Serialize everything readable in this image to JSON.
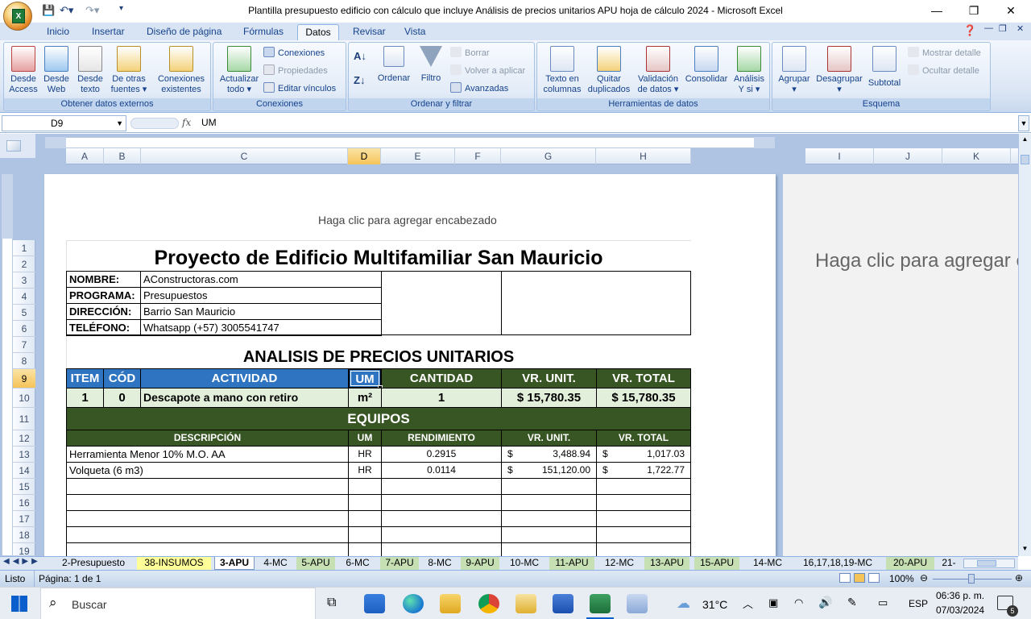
{
  "window": {
    "title": "Plantilla presupuesto edificio con cálculo que incluye Análisis de precios unitarios APU  hoja de cálculo 2024 - Microsoft Excel",
    "office_logo": "X"
  },
  "ribbon_tabs": [
    "Inicio",
    "Insertar",
    "Diseño de página",
    "Fórmulas",
    "Datos",
    "Revisar",
    "Vista"
  ],
  "active_tab": "Datos",
  "ribbon": {
    "g1": {
      "label": "Obtener datos externos",
      "btn1": "Desde\nAccess",
      "btn2": "Desde\nWeb",
      "btn3": "Desde\ntexto",
      "btn4": "De otras\nfuentes ▾",
      "btn5": "Conexiones\nexistentes"
    },
    "g2": {
      "label": "Conexiones",
      "btn1": "Actualizar\ntodo ▾",
      "sm1": "Conexiones",
      "sm2": "Propiedades",
      "sm3": "Editar vínculos"
    },
    "g3": {
      "label": "Ordenar y filtrar",
      "btn1": "Ordenar",
      "btn2": "Filtro",
      "sm1": "Borrar",
      "sm2": "Volver a aplicar",
      "sm3": "Avanzadas"
    },
    "g4": {
      "label": "Herramientas de datos",
      "btn1": "Texto en\ncolumnas",
      "btn2": "Quitar\nduplicados",
      "btn3": "Validación\nde datos ▾",
      "btn4": "Consolidar",
      "btn5": "Análisis\nY si ▾"
    },
    "g5": {
      "label": "Esquema",
      "btn1": "Agrupar\n▾",
      "btn2": "Desagrupar\n▾",
      "btn3": "Subtotal",
      "sm1": "Mostrar detalle",
      "sm2": "Ocultar detalle"
    }
  },
  "formula_bar": {
    "name_box": "D9",
    "fx": "fx",
    "value": "UM"
  },
  "columns": [
    "A",
    "B",
    "C",
    "D",
    "E",
    "F",
    "G",
    "H",
    "I",
    "J",
    "K"
  ],
  "rows": [
    "1",
    "2",
    "3",
    "4",
    "5",
    "6",
    "7",
    "8",
    "9",
    "10",
    "11",
    "12",
    "13",
    "14",
    "15",
    "16",
    "17",
    "18",
    "19"
  ],
  "page": {
    "header_placeholder": "Haga clic para agregar encabezado",
    "header_placeholder_2": "Haga clic para agregar e"
  },
  "sheet": {
    "title": "Proyecto de Edificio Multifamiliar San Mauricio",
    "info": [
      {
        "label": "NOMBRE:",
        "value": "AConstructoras.com"
      },
      {
        "label": "PROGRAMA:",
        "value": "Presupuestos"
      },
      {
        "label": "DIRECCIÓN:",
        "value": "Barrio San Mauricio"
      },
      {
        "label": "TELÉFONO:",
        "value": "Whatsapp (+57) 3005541747"
      }
    ],
    "apu_title": "ANALISIS DE PRECIOS UNITARIOS",
    "main_headers": {
      "item": "ITEM",
      "cod": "CÓD",
      "actividad": "ACTIVIDAD",
      "um": "UM",
      "cantidad": "CANTIDAD",
      "vr_unit": "VR. UNIT.",
      "vr_total": "VR. TOTAL"
    },
    "main_row": {
      "item": "1",
      "cod": "0",
      "actividad": "Descapote a mano con retiro",
      "um": "m²",
      "cantidad": "1",
      "vr_unit": "$ 15,780.35",
      "vr_total": "$ 15,780.35"
    },
    "equipos_title": "EQUIPOS",
    "equip_headers": {
      "desc": "DESCRIPCIÓN",
      "um": "UM",
      "rend": "RENDIMIENTO",
      "vr_unit": "VR. UNIT.",
      "vr_total": "VR. TOTAL"
    },
    "equip_rows": [
      {
        "desc": "Herramienta Menor 10% M.O. AA",
        "um": "HR",
        "rend": "0.2915",
        "cur1": "$",
        "vr_unit": "3,488.94",
        "cur2": "$",
        "vr_total": "1,017.03"
      },
      {
        "desc": "Volqueta (6 m3)",
        "um": "HR",
        "rend": "0.0114",
        "cur1": "$",
        "vr_unit": "151,120.00",
        "cur2": "$",
        "vr_total": "1,722.77"
      }
    ]
  },
  "sheet_tabs": [
    "2-Presupuesto",
    "38-INSUMOS",
    "3-APU",
    "4-MC",
    "5-APU",
    "6-MC",
    "7-APU",
    "8-MC",
    "9-APU",
    "10-MC",
    "11-APU",
    "12-MC",
    "13-APU",
    "15-APU",
    "14-MC",
    "16,17,18,19-MC",
    "20-APU",
    "21-"
  ],
  "active_sheet": "3-APU",
  "status": {
    "mode": "Listo",
    "page": "Página: 1 de 1",
    "zoom": "100%"
  },
  "taskbar": {
    "search": "Buscar",
    "weather": "31°C",
    "lang": "ESP",
    "time": "06:36 p. m.",
    "date": "07/03/2024",
    "notif": "5"
  },
  "colors": {
    "blue_header": "#2f74c0",
    "green_header": "#375623",
    "light_green": "#e2efda",
    "tab_yellow": "#ffff99",
    "tab_green": "#c6e0b4"
  }
}
